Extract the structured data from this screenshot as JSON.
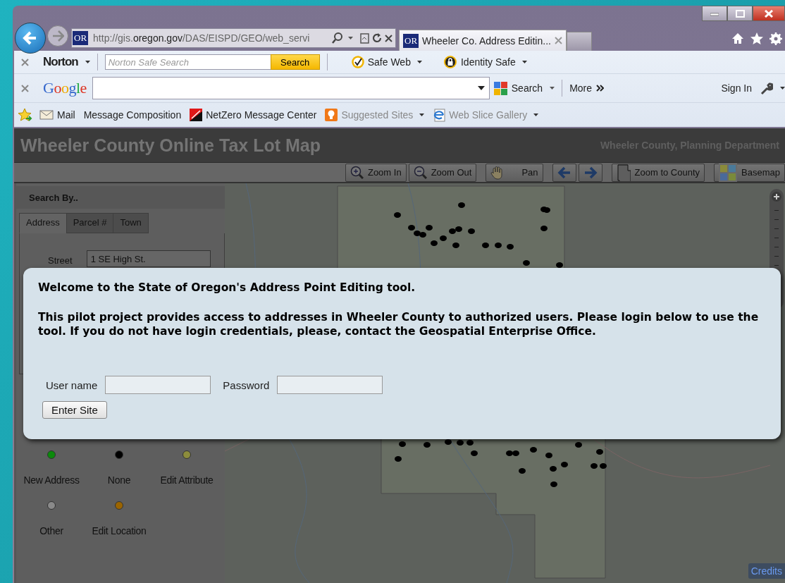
{
  "browser": {
    "address": {
      "favicon": "OR",
      "url": "http://gis.**oregon.gov**/DAS/EISPD/GEO/web_servi"
    },
    "tabs": [
      {
        "favicon": "OR",
        "title": "Wheeler Co. Address Editin...",
        "selected": true
      }
    ],
    "norton": {
      "brand": "Norton",
      "placeholder": "Norton Safe Search",
      "search_button": "Search",
      "items": [
        {
          "kind": "safeweb",
          "label": "Safe Web"
        },
        {
          "kind": "identity",
          "label": "Identity Safe"
        }
      ]
    },
    "google": {
      "brand": "Google",
      "search_button": "Search",
      "more": "More",
      "sign_in": "Sign In"
    },
    "favorites": [
      {
        "kind": "mail",
        "label": "Mail",
        "disabled": false,
        "menu": false
      },
      {
        "kind": "none",
        "label": "Message Composition",
        "disabled": false,
        "menu": false
      },
      {
        "kind": "netzero",
        "label": "NetZero Message Center",
        "disabled": false,
        "menu": false
      },
      {
        "kind": "bulb",
        "label": "Suggested Sites",
        "disabled": true,
        "menu": true
      },
      {
        "kind": "ie",
        "label": "Web Slice Gallery",
        "disabled": true,
        "menu": true
      }
    ]
  },
  "app": {
    "title": "Wheeler County Online Tax Lot Map",
    "subtitle": "Wheeler County, Planning Department",
    "tools": [
      {
        "kind": "zoom-in",
        "label": "Zoom In"
      },
      {
        "kind": "zoom-out",
        "label": "Zoom Out"
      },
      {
        "kind": "pan",
        "label": "Pan"
      },
      {
        "kind": "back"
      },
      {
        "kind": "forward"
      },
      {
        "kind": "county",
        "label": "Zoom to County"
      },
      {
        "kind": "basemap",
        "label": "Basemap"
      }
    ],
    "search_panel": {
      "title": "Search By..",
      "tabs": [
        {
          "label": "Address",
          "selected": true
        },
        {
          "label": "Parcel #",
          "selected": false
        },
        {
          "label": "Town",
          "selected": false
        }
      ],
      "street_label": "Street",
      "street_value": "1 SE High St."
    },
    "legend": [
      {
        "label": "New Address",
        "color": "#0b8a0b"
      },
      {
        "label": "None",
        "color": "#000000"
      },
      {
        "label": "Edit Attribute",
        "color": "#8c8c3c"
      },
      {
        "label": "Other",
        "color": "#8a8a8a"
      },
      {
        "label": "Edit Location",
        "color": "#9a6400"
      }
    ],
    "credits": "Credits"
  },
  "dialog": {
    "heading": "Welcome to the State of Oregon's Address Point Editing tool.",
    "message": "This pilot project provides access to addresses in Wheeler County to authorized users. Please login below to use the tool. If you do not have login credentials, please, contact the Geospatial Enterprise Office.",
    "username_label": "User name",
    "password_label": "Password",
    "submit": "Enter Site"
  }
}
